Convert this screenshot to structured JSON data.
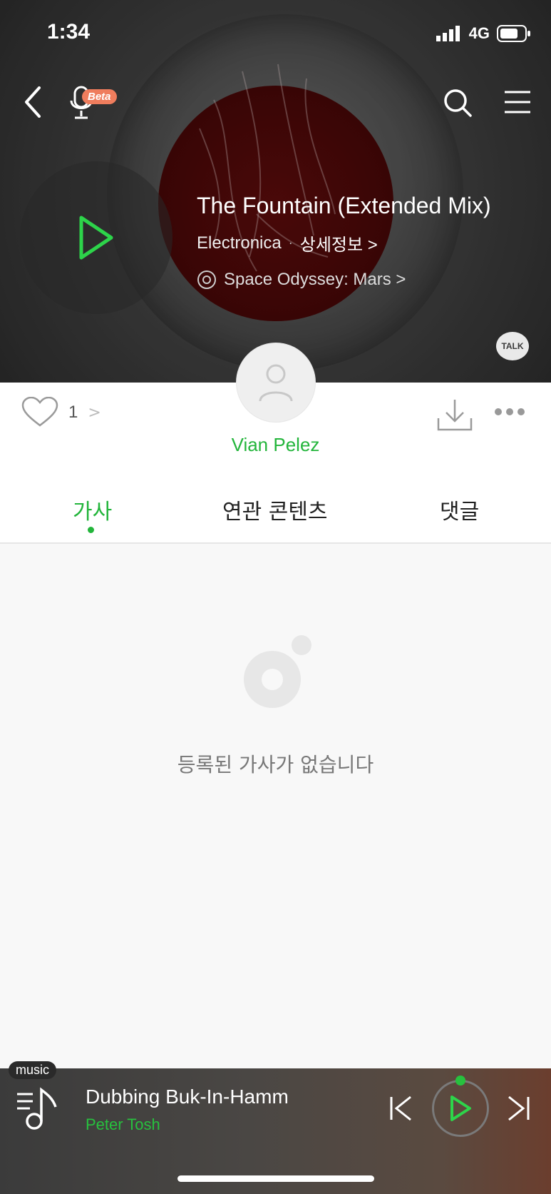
{
  "status": {
    "time": "1:34",
    "network": "4G"
  },
  "header": {
    "beta_label": "Beta"
  },
  "track": {
    "title": "The Fountain (Extended Mix)",
    "genre": "Electronica",
    "separator": "·",
    "detail_link": "상세정보 >",
    "album": "Space Odyssey: Mars >"
  },
  "talk_label": "TALK",
  "actions": {
    "like_count": "1",
    "like_chevron": ">"
  },
  "artist": {
    "name": "Vian Pelez"
  },
  "tabs": [
    {
      "label": "가사"
    },
    {
      "label": "연관 콘텐츠"
    },
    {
      "label": "댓글"
    }
  ],
  "lyrics": {
    "empty_message": "등록된 가사가 없습니다"
  },
  "mini_player": {
    "badge": "music",
    "song": "Dubbing Buk-In-Hamm",
    "artist": "Peter Tosh"
  },
  "colors": {
    "accent": "#23b53b",
    "beta": "#ef7d5d"
  },
  "icons": [
    "back-icon",
    "mic-icon",
    "search-icon",
    "menu-icon",
    "play-icon",
    "disc-icon",
    "heart-icon",
    "user-icon",
    "download-icon",
    "more-icon",
    "lyrics-empty-icon",
    "playlist-icon",
    "prev-icon",
    "next-icon"
  ]
}
